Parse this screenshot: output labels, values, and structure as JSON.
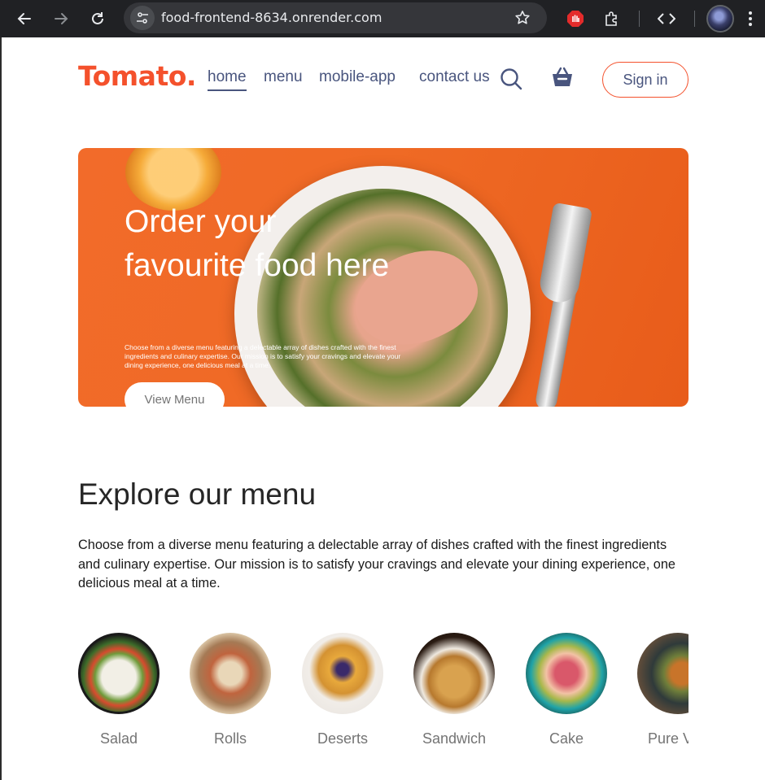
{
  "browser": {
    "url": "food-frontend-8634.onrender.com",
    "icons": [
      "back-arrow-icon",
      "forward-arrow-icon",
      "reload-icon",
      "site-settings-icon",
      "bookmark-star-icon",
      "adblock-extension-icon",
      "extensions-puzzle-icon",
      "devtools-code-icon",
      "profile-avatar"
    ]
  },
  "navbar": {
    "logo": "Tomato.",
    "links": [
      "home",
      "menu",
      "mobile-app",
      "contact us"
    ],
    "active_link": "home",
    "sign_in": "Sign in"
  },
  "hero": {
    "title": "Order your favourite food here",
    "description": "Choose from a diverse menu featuring a delectable array of dishes crafted with the finest ingredients and culinary expertise. Our mission is to satisfy your cravings and elevate your dining experience, one delicious meal at a time.",
    "button": "View Menu"
  },
  "explore": {
    "title": "Explore our menu",
    "description": "Choose from a diverse menu featuring a delectable array of dishes crafted with the finest ingredients and culinary expertise. Our mission is to satisfy your cravings and elevate your dining experience, one delicious meal at a time.",
    "items": [
      {
        "label": "Salad"
      },
      {
        "label": "Rolls"
      },
      {
        "label": "Deserts"
      },
      {
        "label": "Sandwich"
      },
      {
        "label": "Cake"
      },
      {
        "label": "Pure Veg"
      }
    ]
  },
  "colors": {
    "brand": "#f4512c",
    "nav_text": "#49557e",
    "hero_bg": "#f26b2a",
    "chrome_bg": "#202124"
  }
}
